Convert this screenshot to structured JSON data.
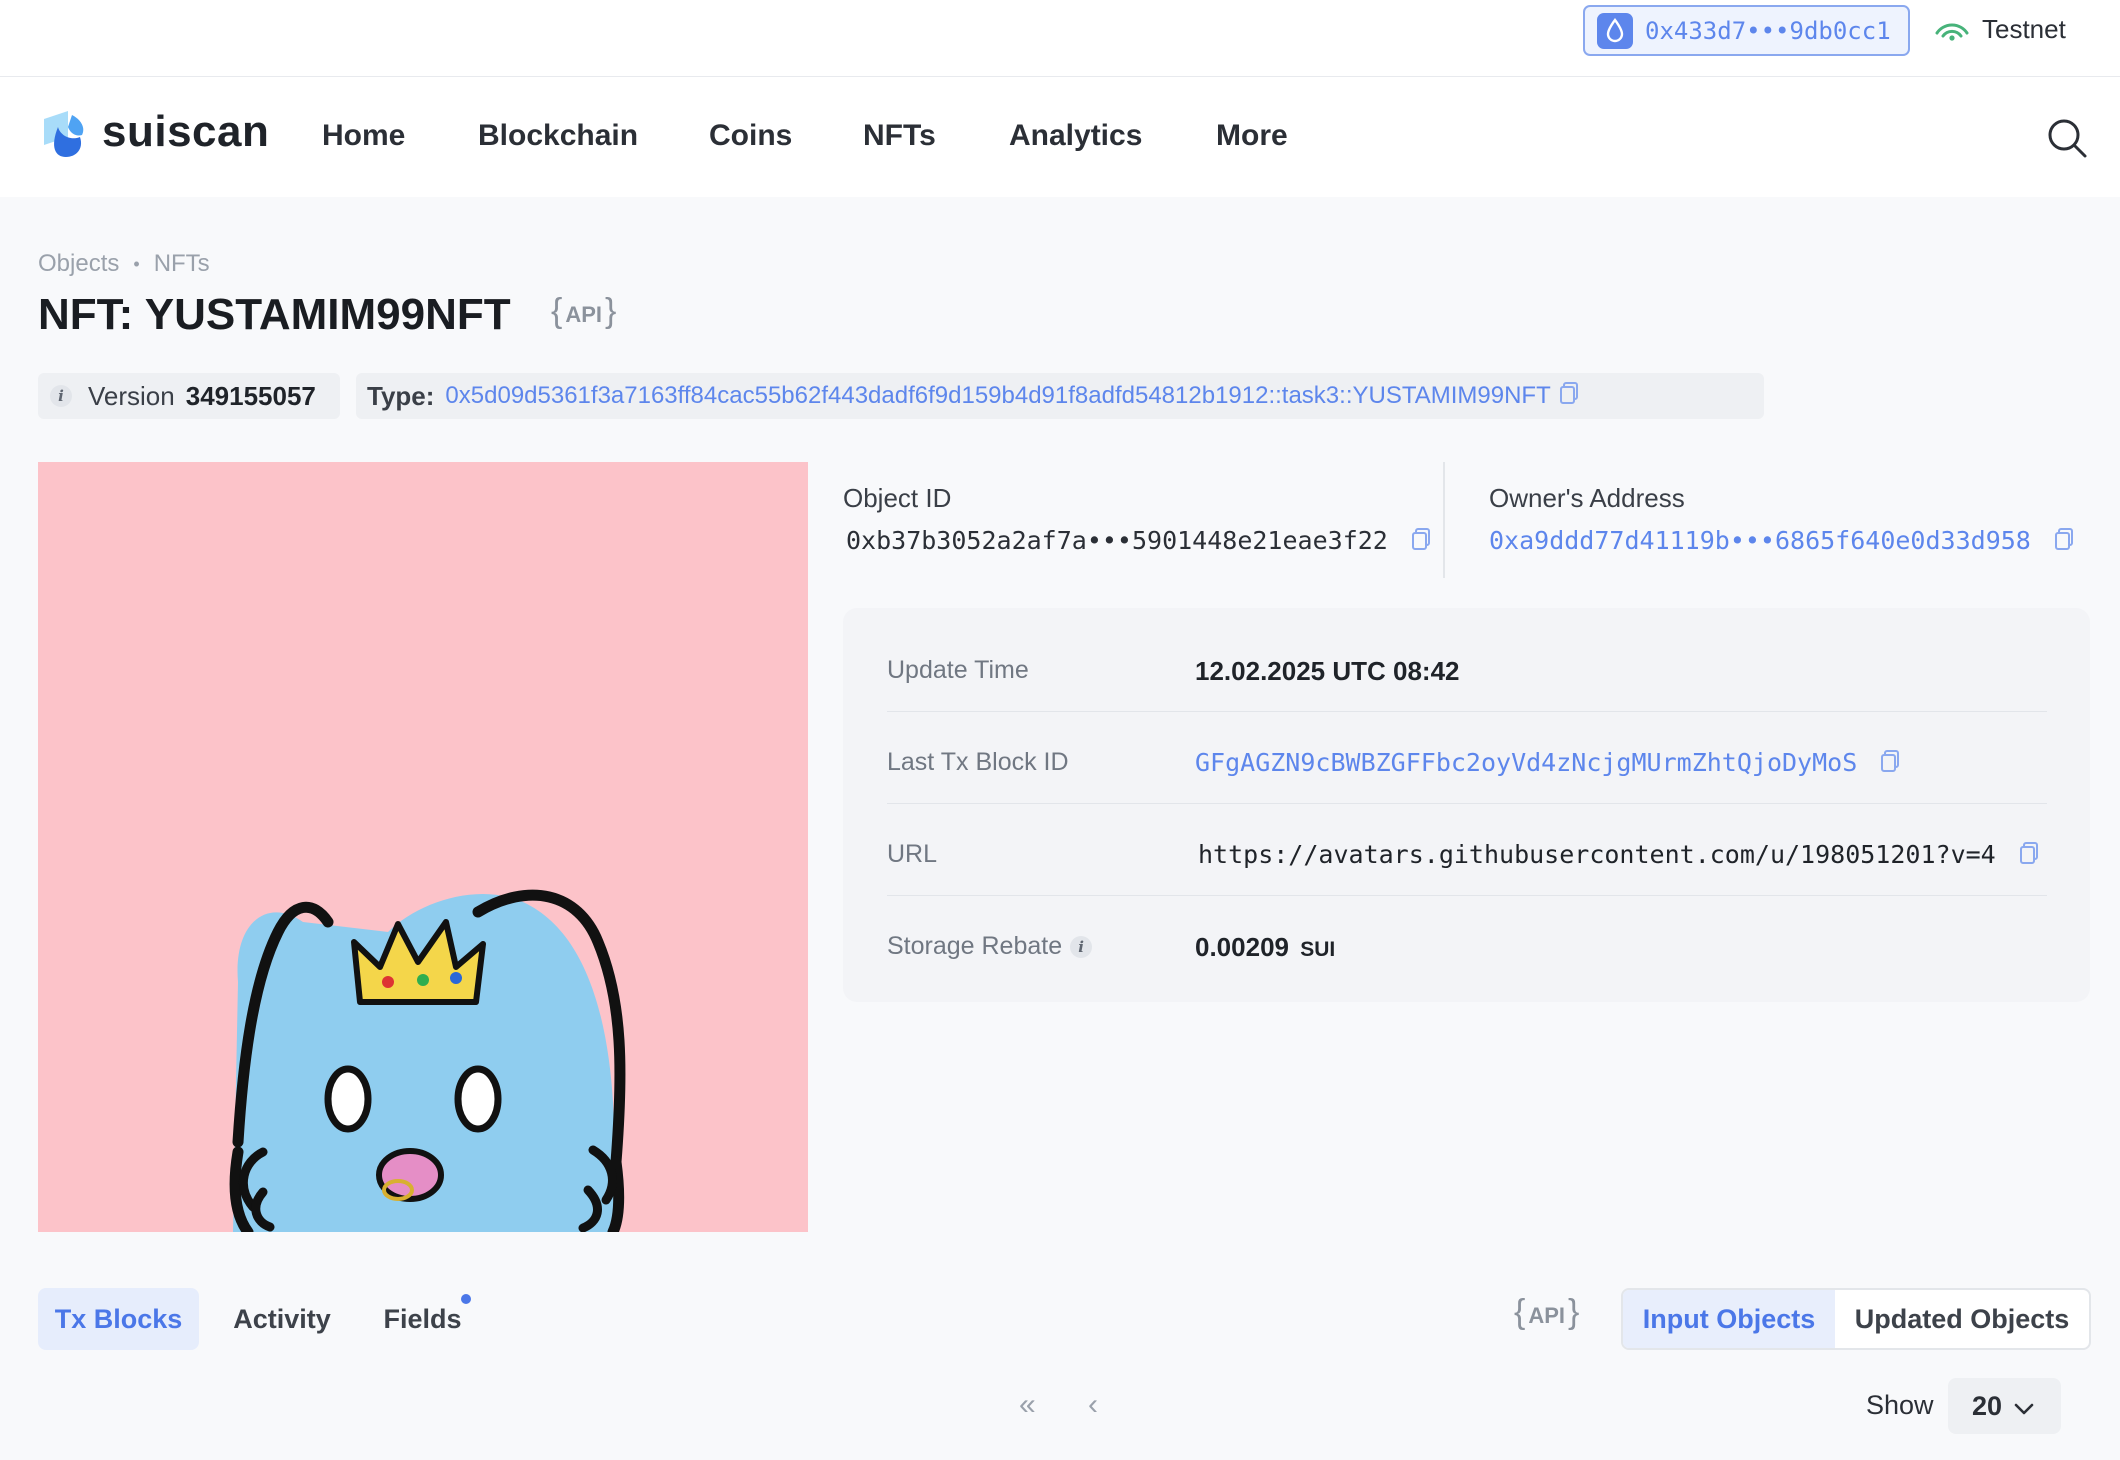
{
  "topbar": {
    "wallet_address": "0x433d7•••9db0cc1",
    "network": "Testnet"
  },
  "nav": {
    "logo_text": "suiscan",
    "items": [
      "Home",
      "Blockchain",
      "Coins",
      "NFTs",
      "Analytics",
      "More"
    ]
  },
  "breadcrumb": [
    "Objects",
    "NFTs"
  ],
  "page": {
    "title": "NFT: YUSTAMIM99NFT",
    "api_label": "API"
  },
  "meta": {
    "version_label": "Version",
    "version": "349155057",
    "type_label": "Type:",
    "type": "0x5d09d5361f3a7163ff84cac55b62f443dadf6f9d159b4d91f8adfd54812b1912::task3::YUSTAMIM99NFT"
  },
  "ids": {
    "object_id_label": "Object ID",
    "object_id": "0xb37b3052a2af7a•••5901448e21eae3f22",
    "owner_label": "Owner's Address",
    "owner": "0xa9ddd77d41119b•••6865f640e0d33d958"
  },
  "details": {
    "update_time_label": "Update Time",
    "update_time": "12.02.2025 UTC 08:42",
    "last_tx_label": "Last Tx Block ID",
    "last_tx": "GFgAGZN9cBWBZGFFbc2oyVd4zNcjgMUrmZhtQjoDyMoS",
    "url_label": "URL",
    "url": "https://avatars.githubusercontent.com/u/198051201?v=4",
    "storage_label": "Storage Rebate",
    "storage_value": "0.00209",
    "storage_unit": "SUI"
  },
  "tabs": [
    "Tx Blocks",
    "Activity",
    "Fields"
  ],
  "segments": [
    "Input Objects",
    "Updated Objects"
  ],
  "pagination": {
    "first": "«",
    "prev": "‹",
    "show_label": "Show",
    "page_size": "20"
  },
  "colors": {
    "accent": "#5d86ec",
    "nft_background": "#fcc3c9",
    "cat_body": "#8fcdef"
  }
}
